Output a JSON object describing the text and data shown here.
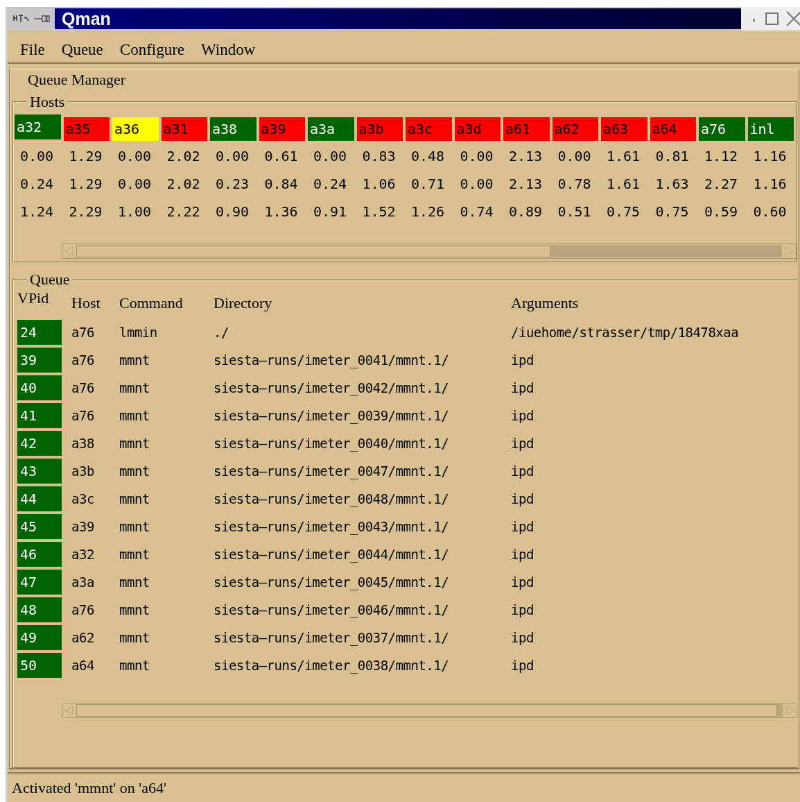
{
  "window": {
    "title": "Qman"
  },
  "menu": [
    "File",
    "Queue",
    "Configure",
    "Window"
  ],
  "queue_manager": {
    "title": "Queue Manager",
    "hosts": {
      "title": "Hosts",
      "items": [
        {
          "name": "a32",
          "color": "#006400",
          "loads": [
            "0.00",
            "0.24",
            "1.24"
          ]
        },
        {
          "name": "a35",
          "color": "#ff0000",
          "loads": [
            "1.29",
            "1.29",
            "2.29"
          ]
        },
        {
          "name": "a36",
          "color": "#ffff00",
          "loads": [
            "0.00",
            "0.00",
            "1.00"
          ]
        },
        {
          "name": "a31",
          "color": "#ff0000",
          "loads": [
            "2.02",
            "2.02",
            "2.22"
          ]
        },
        {
          "name": "a38",
          "color": "#006400",
          "loads": [
            "0.00",
            "0.23",
            "0.90"
          ]
        },
        {
          "name": "a39",
          "color": "#ff0000",
          "loads": [
            "0.61",
            "0.84",
            "1.36"
          ]
        },
        {
          "name": "a3a",
          "color": "#006400",
          "loads": [
            "0.00",
            "0.24",
            "0.91"
          ]
        },
        {
          "name": "a3b",
          "color": "#ff0000",
          "loads": [
            "0.83",
            "1.06",
            "1.52"
          ]
        },
        {
          "name": "a3c",
          "color": "#ff0000",
          "loads": [
            "0.48",
            "0.71",
            "1.26"
          ]
        },
        {
          "name": "a3d",
          "color": "#ff0000",
          "loads": [
            "0.00",
            "0.00",
            "0.74"
          ]
        },
        {
          "name": "a61",
          "color": "#ff0000",
          "loads": [
            "2.13",
            "2.13",
            "0.89"
          ]
        },
        {
          "name": "a62",
          "color": "#ff0000",
          "loads": [
            "0.00",
            "0.78",
            "0.51"
          ]
        },
        {
          "name": "a63",
          "color": "#ff0000",
          "loads": [
            "1.61",
            "1.61",
            "0.75"
          ]
        },
        {
          "name": "a64",
          "color": "#ff0000",
          "loads": [
            "0.81",
            "1.63",
            "0.75"
          ]
        },
        {
          "name": "a76",
          "color": "#006400",
          "loads": [
            "1.12",
            "2.27",
            "0.59"
          ]
        },
        {
          "name": "inl",
          "color": "#006400",
          "loads": [
            "1.16",
            "1.16",
            "0.60"
          ]
        }
      ]
    },
    "queue": {
      "title": "Queue",
      "columns": [
        "VPid",
        "Host",
        "Command",
        "Directory",
        "Arguments"
      ],
      "rows": [
        {
          "vpid": "24",
          "color": "#006400",
          "host": "a76",
          "command": "lmmin",
          "directory": "./",
          "arguments": "/iuehome/strasser/tmp/18478xaa"
        },
        {
          "vpid": "39",
          "color": "#006400",
          "host": "a76",
          "command": "mmnt",
          "directory": "siesta–runs/imeter_0041/mmnt.1/",
          "arguments": "ipd"
        },
        {
          "vpid": "40",
          "color": "#006400",
          "host": "a76",
          "command": "mmnt",
          "directory": "siesta–runs/imeter_0042/mmnt.1/",
          "arguments": "ipd"
        },
        {
          "vpid": "41",
          "color": "#006400",
          "host": "a76",
          "command": "mmnt",
          "directory": "siesta–runs/imeter_0039/mmnt.1/",
          "arguments": "ipd"
        },
        {
          "vpid": "42",
          "color": "#006400",
          "host": "a38",
          "command": "mmnt",
          "directory": "siesta–runs/imeter_0040/mmnt.1/",
          "arguments": "ipd"
        },
        {
          "vpid": "43",
          "color": "#006400",
          "host": "a3b",
          "command": "mmnt",
          "directory": "siesta–runs/imeter_0047/mmnt.1/",
          "arguments": "ipd"
        },
        {
          "vpid": "44",
          "color": "#006400",
          "host": "a3c",
          "command": "mmnt",
          "directory": "siesta–runs/imeter_0048/mmnt.1/",
          "arguments": "ipd"
        },
        {
          "vpid": "45",
          "color": "#006400",
          "host": "a39",
          "command": "mmnt",
          "directory": "siesta–runs/imeter_0043/mmnt.1/",
          "arguments": "ipd"
        },
        {
          "vpid": "46",
          "color": "#006400",
          "host": "a32",
          "command": "mmnt",
          "directory": "siesta–runs/imeter_0044/mmnt.1/",
          "arguments": "ipd"
        },
        {
          "vpid": "47",
          "color": "#006400",
          "host": "a3a",
          "command": "mmnt",
          "directory": "siesta–runs/imeter_0045/mmnt.1/",
          "arguments": "ipd"
        },
        {
          "vpid": "48",
          "color": "#006400",
          "host": "a76",
          "command": "mmnt",
          "directory": "siesta–runs/imeter_0046/mmnt.1/",
          "arguments": "ipd"
        },
        {
          "vpid": "49",
          "color": "#006400",
          "host": "a62",
          "command": "mmnt",
          "directory": "siesta–runs/imeter_0037/mmnt.1/",
          "arguments": "ipd"
        },
        {
          "vpid": "50",
          "color": "#006400",
          "host": "a64",
          "command": "mmnt",
          "directory": "siesta–runs/imeter_0038/mmnt.1/",
          "arguments": "ipd"
        }
      ]
    }
  },
  "status_bar": "Activated 'mmnt' on 'a64'"
}
